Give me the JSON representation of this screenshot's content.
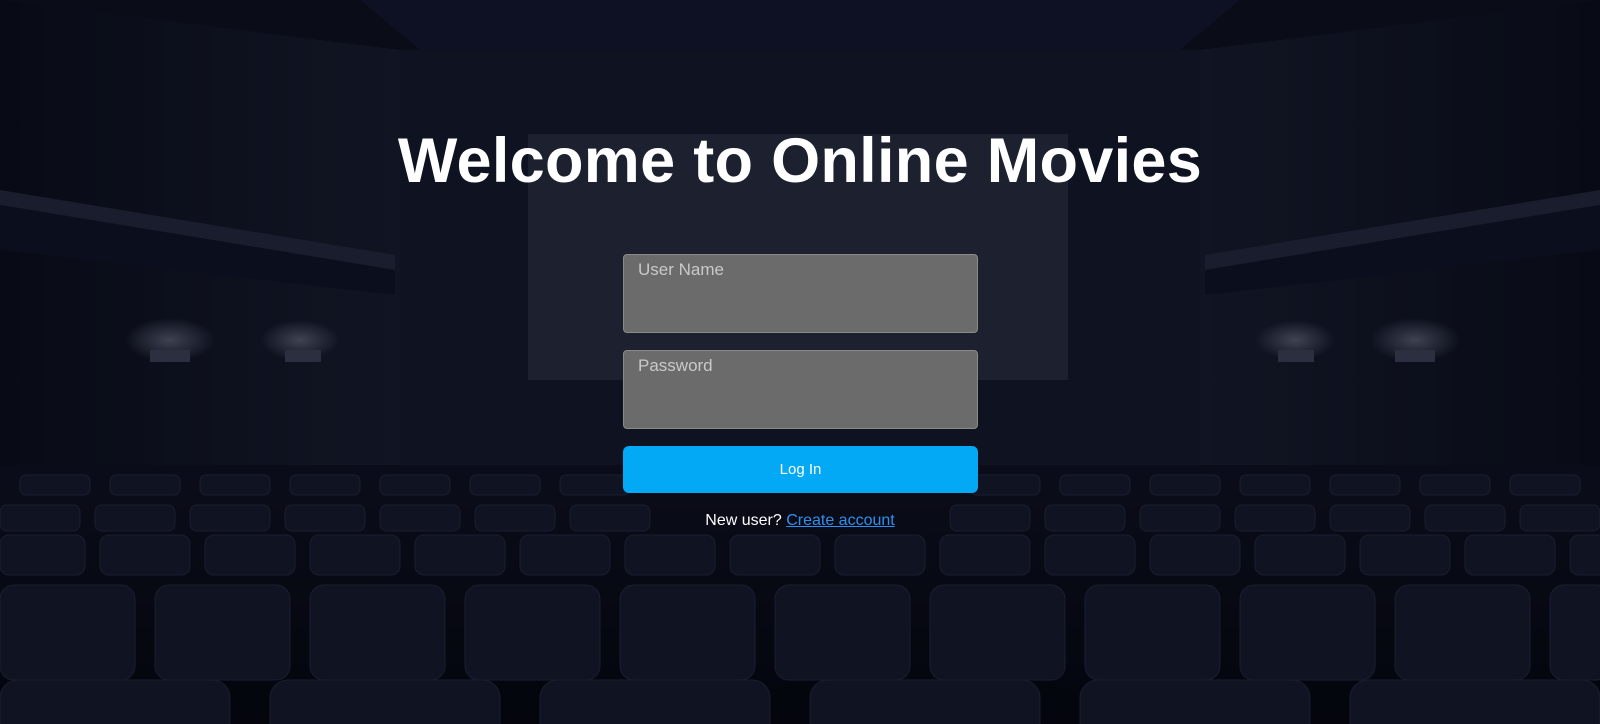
{
  "page": {
    "title": "Welcome to Online Movies"
  },
  "login_form": {
    "username_placeholder": "User Name",
    "password_placeholder": "Password",
    "login_button_label": "Log In",
    "signup_prompt": "New user?",
    "signup_link_label": "Create account"
  },
  "colors": {
    "accent": "#03a9f4",
    "link": "#2f8ff0",
    "field_bg": "#6b6b6b"
  }
}
